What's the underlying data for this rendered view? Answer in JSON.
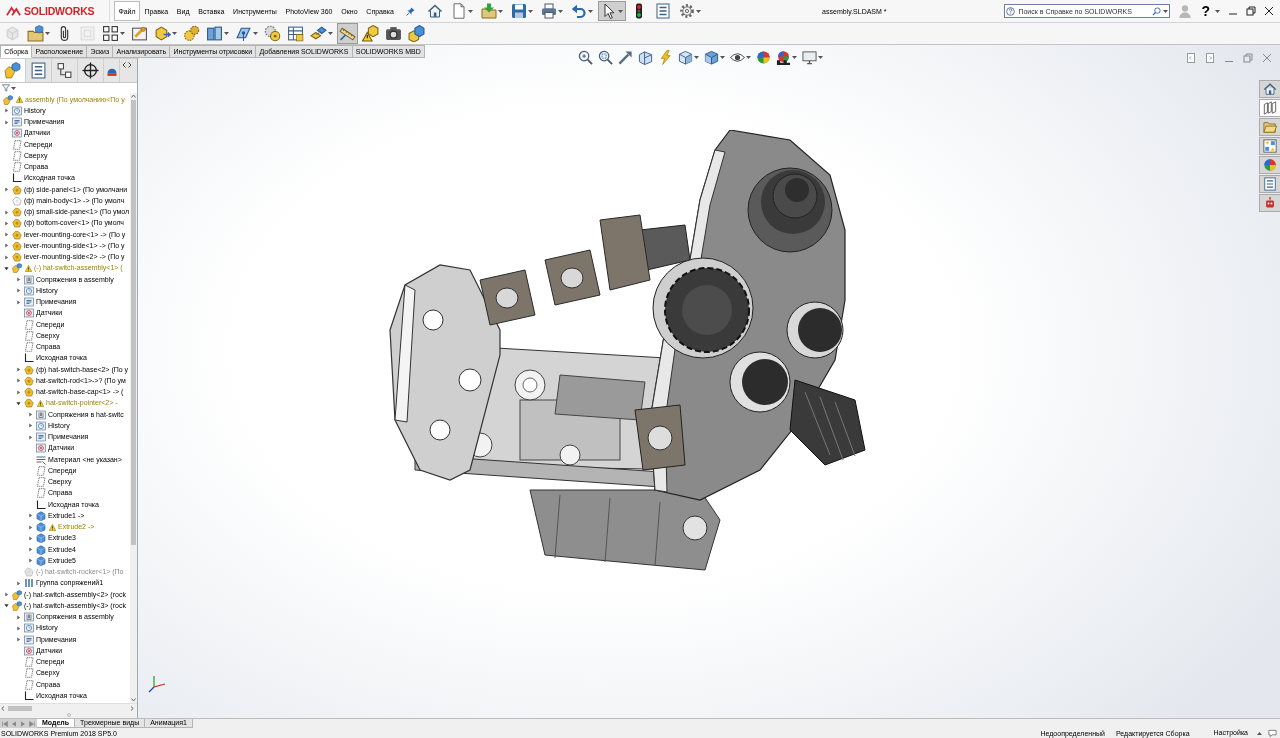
{
  "app": {
    "logo": "SOLIDWORKS",
    "title": "assembly.SLDASM *"
  },
  "menu": [
    {
      "label": "Файл",
      "selected": true
    },
    {
      "label": "Правка",
      "selected": false
    },
    {
      "label": "Вид",
      "selected": false
    },
    {
      "label": "Вставка",
      "selected": false
    },
    {
      "label": "Инструменты",
      "selected": false
    },
    {
      "label": "PhotoView 360",
      "selected": false
    },
    {
      "label": "Окно",
      "selected": false
    },
    {
      "label": "Справка",
      "selected": false
    }
  ],
  "quick_toolbar": [
    {
      "kind": "home",
      "pressed": false,
      "menu": false
    },
    {
      "kind": "new",
      "pressed": false,
      "menu": true
    },
    {
      "kind": "open",
      "pressed": false,
      "menu": true
    },
    {
      "kind": "save",
      "pressed": false,
      "menu": true
    },
    {
      "kind": "print",
      "pressed": false,
      "menu": true
    },
    {
      "kind": "undo",
      "pressed": false,
      "menu": true
    },
    {
      "kind": "select",
      "pressed": true,
      "menu": true
    },
    {
      "kind": "rebuild",
      "pressed": false,
      "menu": false
    },
    {
      "kind": "properties",
      "pressed": false,
      "menu": false
    },
    {
      "kind": "options",
      "pressed": false,
      "menu": true
    }
  ],
  "search": {
    "placeholder": "Поиск в Справке по SOLIDWORKS"
  },
  "help": {
    "label": "?"
  },
  "command_toolbar": [
    {
      "kind": "insert-component",
      "pressed": false,
      "menu": false,
      "disabled": true
    },
    {
      "kind": "open-component",
      "pressed": false,
      "menu": true,
      "disabled": false
    },
    {
      "kind": "mate",
      "pressed": false,
      "menu": false,
      "disabled": false
    },
    {
      "kind": "component-preview",
      "pressed": false,
      "menu": false,
      "disabled": true
    },
    {
      "kind": "pattern",
      "pressed": false,
      "menu": true,
      "disabled": false
    },
    {
      "kind": "smart-fasteners",
      "pressed": false,
      "menu": false,
      "disabled": false
    },
    {
      "kind": "move-component",
      "pressed": false,
      "menu": true,
      "disabled": false
    },
    {
      "kind": "hide-show",
      "pressed": false,
      "menu": false,
      "disabled": false
    },
    {
      "kind": "assembly-features",
      "pressed": false,
      "menu": true,
      "disabled": false
    },
    {
      "kind": "reference-geometry",
      "pressed": false,
      "menu": true,
      "disabled": false
    },
    {
      "kind": "new-motion",
      "pressed": false,
      "menu": false,
      "disabled": false
    },
    {
      "kind": "bom",
      "pressed": false,
      "menu": false,
      "disabled": false
    },
    {
      "kind": "exploded-view",
      "pressed": false,
      "menu": true,
      "disabled": false
    },
    {
      "kind": "instant3d",
      "pressed": true,
      "menu": false,
      "disabled": false
    },
    {
      "kind": "update-speedpak",
      "pressed": false,
      "menu": false,
      "disabled": false
    },
    {
      "kind": "snapshot",
      "pressed": false,
      "menu": false,
      "disabled": false
    },
    {
      "kind": "large-assembly",
      "pressed": false,
      "menu": false,
      "disabled": false
    }
  ],
  "command_tabs": [
    {
      "label": "Сборка",
      "selected": true
    },
    {
      "label": "Расположение",
      "selected": false
    },
    {
      "label": "Эскиз",
      "selected": false
    },
    {
      "label": "Анализировать",
      "selected": false
    },
    {
      "label": "Инструменты отрисовки",
      "selected": false
    },
    {
      "label": "Добавления SOLIDWORKS",
      "selected": false
    },
    {
      "label": "SOLIDWORKS MBD",
      "selected": false
    }
  ],
  "panel_tabs": [
    {
      "kind": "feature-manager",
      "selected": true
    },
    {
      "kind": "property-manager",
      "selected": false
    },
    {
      "kind": "configuration-manager",
      "selected": false
    },
    {
      "kind": "dimxpert",
      "selected": false
    },
    {
      "kind": "display-manager",
      "selected": false
    }
  ],
  "feature_tree": {
    "items": [
      {
        "label": "assembly (По умолчанию<По у",
        "kind": "assembly",
        "warning": true,
        "children": [
          {
            "label": "History",
            "kind": "history",
            "expanded": false
          },
          {
            "label": "Примечания",
            "kind": "annotations",
            "expanded": false
          },
          {
            "label": "Датчики",
            "kind": "sensors"
          },
          {
            "label": "Спереди",
            "kind": "plane"
          },
          {
            "label": "Сверху",
            "kind": "plane"
          },
          {
            "label": "Справа",
            "kind": "plane"
          },
          {
            "label": "Исходная точка",
            "kind": "origin"
          },
          {
            "label": "(ф) side-panel<1> (По умолчани",
            "kind": "part",
            "expanded": false
          },
          {
            "label": "(ф) main-body<1> -> (По умолч",
            "kind": "part",
            "hidden": true
          },
          {
            "label": "(ф) small-side-pane<1> (По умол",
            "kind": "part",
            "expanded": false
          },
          {
            "label": "(ф) bottom-cover<1> (По умолч",
            "kind": "part",
            "expanded": false
          },
          {
            "label": "lever-mounting-core<1> -> (По у",
            "kind": "part",
            "expanded": false
          },
          {
            "label": "lever-mounting-side<1> -> (По у",
            "kind": "part",
            "expanded": false
          },
          {
            "label": "lever-mounting-side<2> -> (По у",
            "kind": "part",
            "expanded": false
          },
          {
            "label": "(-) hat-switch-assembly<1> (",
            "kind": "assembly",
            "expanded": true,
            "warning": true,
            "children": [
              {
                "label": "Сопряжения в assembly",
                "kind": "mates",
                "expanded": false
              },
              {
                "label": "History",
                "kind": "history",
                "expanded": false
              },
              {
                "label": "Примечания",
                "kind": "annotations",
                "expanded": false
              },
              {
                "label": "Датчики",
                "kind": "sensors"
              },
              {
                "label": "Спереди",
                "kind": "plane"
              },
              {
                "label": "Сверху",
                "kind": "plane"
              },
              {
                "label": "Справа",
                "kind": "plane"
              },
              {
                "label": "Исходная точка",
                "kind": "origin"
              },
              {
                "label": "(ф) hat-switch-base<2> (По у",
                "kind": "part",
                "expanded": false
              },
              {
                "label": "hat-switch-rod<1>->? (По ум",
                "kind": "part",
                "expanded": false
              },
              {
                "label": "hat-switch-base-cap<1> -> (",
                "kind": "part",
                "expanded": false
              },
              {
                "label": "hat-switch-pointer<2> -",
                "kind": "part",
                "expanded": true,
                "warning": true,
                "children": [
                  {
                    "label": "Сопряжения в hat-switc",
                    "kind": "mates",
                    "expanded": false
                  },
                  {
                    "label": "History",
                    "kind": "history",
                    "expanded": false
                  },
                  {
                    "label": "Примечания",
                    "kind": "annotations",
                    "expanded": false
                  },
                  {
                    "label": "Датчики",
                    "kind": "sensors"
                  },
                  {
                    "label": "Материал <не указан>",
                    "kind": "material"
                  },
                  {
                    "label": "Спереди",
                    "kind": "plane"
                  },
                  {
                    "label": "Сверху",
                    "kind": "plane"
                  },
                  {
                    "label": "Справа",
                    "kind": "plane"
                  },
                  {
                    "label": "Исходная точка",
                    "kind": "origin"
                  },
                  {
                    "label": "Extrude1 ->",
                    "kind": "feature",
                    "expanded": false
                  },
                  {
                    "label": "Extrude2 ->",
                    "kind": "feature",
                    "expanded": false,
                    "warning": true
                  },
                  {
                    "label": "Extrude3",
                    "kind": "feature",
                    "expanded": false
                  },
                  {
                    "label": "Extrude4",
                    "kind": "feature",
                    "expanded": false
                  },
                  {
                    "label": "Extrude5",
                    "kind": "feature",
                    "expanded": false
                  }
                ]
              },
              {
                "label": "(-) hat-switch-rocker<1> (По",
                "kind": "part",
                "suppressed": true
              },
              {
                "label": "Группа сопряжений1",
                "kind": "mate-group",
                "expanded": false
              }
            ]
          },
          {
            "label": "(-) hat-switch-assembly<2> (rock",
            "kind": "assembly",
            "expanded": false
          },
          {
            "label": "(-) hat-switch-assembly<3> (rock",
            "kind": "assembly",
            "expanded": true,
            "children": [
              {
                "label": "Сопряжения в assembly",
                "kind": "mates",
                "expanded": false
              },
              {
                "label": "History",
                "kind": "history",
                "expanded": false
              },
              {
                "label": "Примечания",
                "kind": "annotations",
                "expanded": false
              },
              {
                "label": "Датчики",
                "kind": "sensors"
              },
              {
                "label": "Спереди",
                "kind": "plane"
              },
              {
                "label": "Сверху",
                "kind": "plane"
              },
              {
                "label": "Справа",
                "kind": "plane"
              },
              {
                "label": "Исходная точка",
                "kind": "origin"
              }
            ]
          }
        ]
      }
    ]
  },
  "heads_up_toolbar": [
    {
      "kind": "zoom-fit",
      "menu": false
    },
    {
      "kind": "zoom-area",
      "menu": false
    },
    {
      "kind": "previous-view",
      "menu": false
    },
    {
      "kind": "section-view",
      "menu": false
    },
    {
      "kind": "dynamic-annotation",
      "menu": false
    },
    {
      "kind": "view-orientation",
      "menu": true
    },
    {
      "kind": "display-style",
      "menu": true
    },
    {
      "kind": "hide-show-items",
      "menu": true
    },
    {
      "kind": "edit-appearance",
      "menu": false
    },
    {
      "kind": "apply-scene",
      "menu": true
    },
    {
      "kind": "view-settings",
      "menu": true
    }
  ],
  "task_pane": [
    {
      "kind": "resources",
      "selected": false
    },
    {
      "kind": "design-library",
      "selected": true
    },
    {
      "kind": "file-explorer",
      "selected": false
    },
    {
      "kind": "view-palette",
      "selected": false
    },
    {
      "kind": "appearances",
      "selected": false
    },
    {
      "kind": "custom-properties",
      "selected": false
    },
    {
      "kind": "forum",
      "selected": false
    }
  ],
  "bottom_tabs": [
    {
      "label": "Модель",
      "selected": true
    },
    {
      "label": "Трехмерные виды",
      "selected": false
    },
    {
      "label": "Анимация1",
      "selected": false
    }
  ],
  "status_bar": {
    "product": "SOLIDWORKS Premium 2018 SP5.0",
    "status": "Недоопределенный",
    "mode": "Редактируется Сборка",
    "units": "Настройка"
  }
}
